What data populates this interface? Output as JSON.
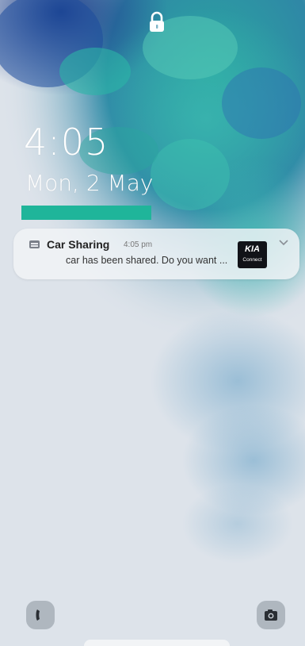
{
  "status_bar": {
    "lock_icon": "padlock-icon"
  },
  "clock": {
    "time": "4:05",
    "date": "Mon, 2 May"
  },
  "notification": {
    "app_icon": "car-sharing-app-icon",
    "app_name": "Car Sharing",
    "time": "4:05 pm",
    "body": "car has been shared. Do you want ...",
    "brand_logo": {
      "mark": "KIA",
      "sub": "Connect"
    },
    "expand_icon": "chevron-down-icon"
  },
  "shortcuts": {
    "left_icon": "phone-icon",
    "right_icon": "camera-icon"
  },
  "colors": {
    "redaction": "#1fb59a",
    "wallpaper_base": "#d8dfe8"
  }
}
